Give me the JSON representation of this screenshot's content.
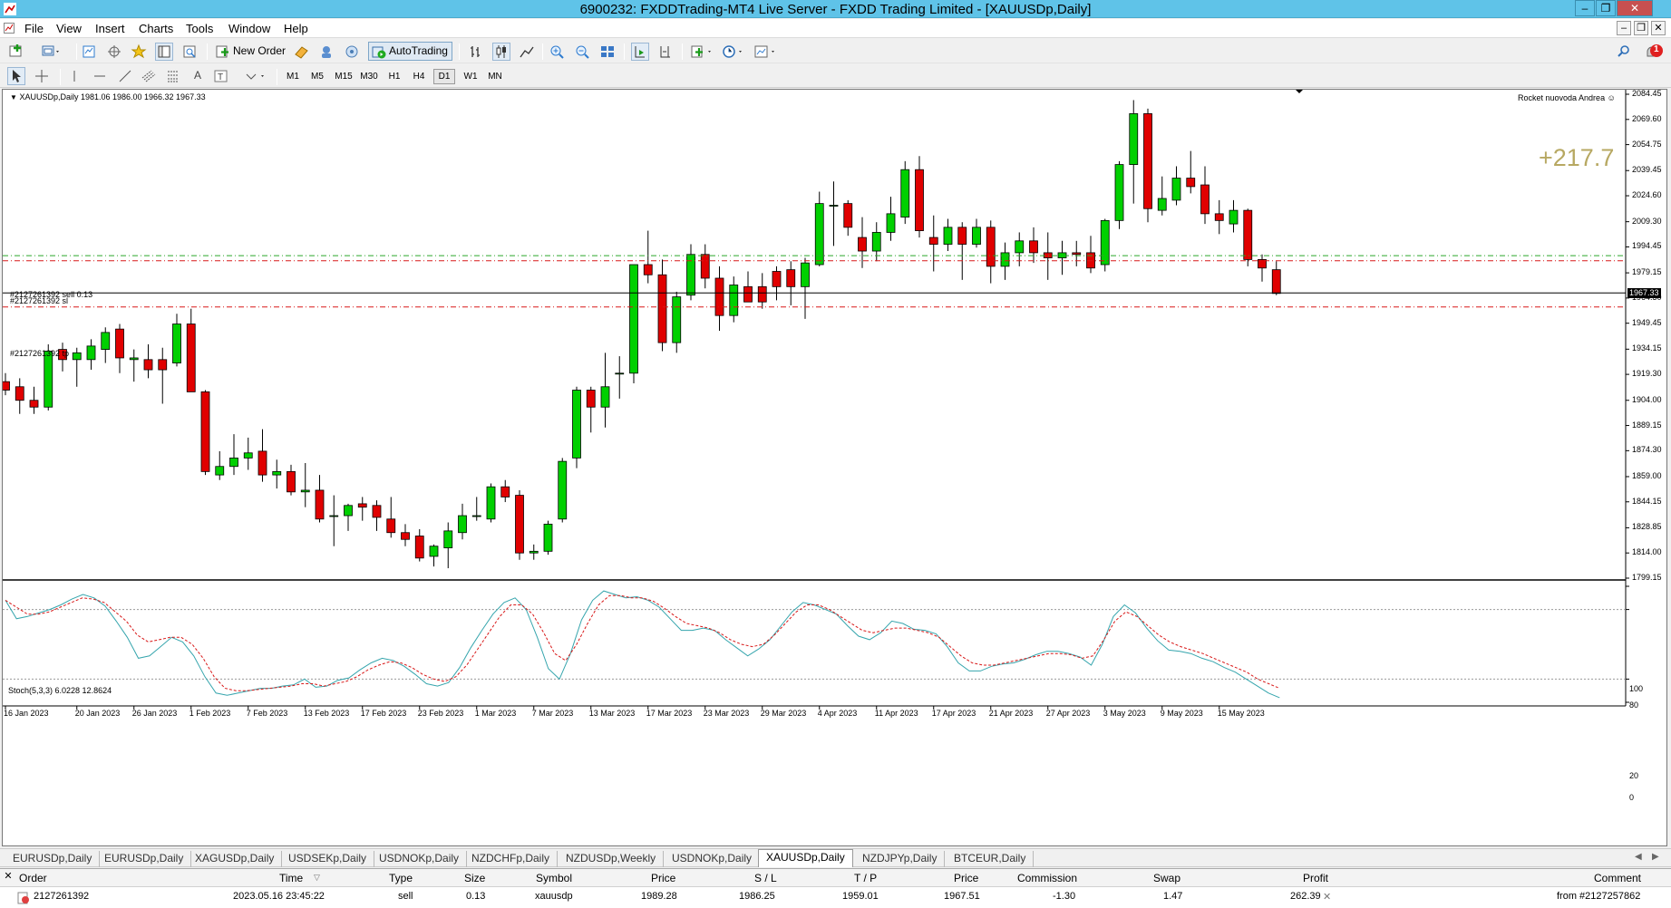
{
  "window": {
    "title": "6900232: FXDDTrading-MT4 Live Server - FXDD Trading Limited - [XAUUSDp,Daily]"
  },
  "menu": [
    "File",
    "View",
    "Insert",
    "Charts",
    "Tools",
    "Window",
    "Help"
  ],
  "toolbar": {
    "new_order": "New Order",
    "autotrading": "AutoTrading",
    "notification_count": "1",
    "timeframes": [
      "M1",
      "M5",
      "M15",
      "M30",
      "H1",
      "H4",
      "D1",
      "W1",
      "MN"
    ],
    "active_timeframe": "D1"
  },
  "chart": {
    "header": "XAUUSDp,Daily  1981.06 1986.00 1966.32 1967.33",
    "expert": "Rocket nuovoda Andrea",
    "profit_overlay": "+217.7",
    "order_line_label": "#2127261392 sell 0.13",
    "sl_label": "#2127261392 sl",
    "tp_label": "#2127261392 tp",
    "current_price": "1967.33",
    "price_axis": [
      "2084.45",
      "2069.60",
      "2054.75",
      "2039.45",
      "2024.60",
      "2009.30",
      "1994.45",
      "1979.15",
      "1964.30",
      "1949.45",
      "1934.15",
      "1919.30",
      "1904.00",
      "1889.15",
      "1874.30",
      "1859.00",
      "1844.15",
      "1828.85",
      "1814.00",
      "1799.15"
    ],
    "indicator_header": "Stoch(5,3,3) 6.0228 12.8624",
    "indicator_axis": [
      "100",
      "80",
      "20",
      "0"
    ],
    "date_axis": [
      "16 Jan 2023",
      "20 Jan 2023",
      "26 Jan 2023",
      "1 Feb 2023",
      "7 Feb 2023",
      "13 Feb 2023",
      "17 Feb 2023",
      "23 Feb 2023",
      "1 Mar 2023",
      "7 Mar 2023",
      "13 Mar 2023",
      "17 Mar 2023",
      "23 Mar 2023",
      "29 Mar 2023",
      "4 Apr 2023",
      "11 Apr 2023",
      "17 Apr 2023",
      "21 Apr 2023",
      "27 Apr 2023",
      "3 May 2023",
      "9 May 2023",
      "15 May 2023"
    ],
    "colors": {
      "bull": "#00d000",
      "bear": "#e00000",
      "order_line": "#2aa82a",
      "sl_tp_line": "#d81818",
      "stoch_main": "#35a5ad",
      "stoch_signal": "#d81818",
      "profit": "#b7a862"
    }
  },
  "chart_data": {
    "type": "candlestick",
    "title": "XAUUSDp,Daily",
    "ylim": [
      1799.15,
      2084.45
    ],
    "candles": [
      {
        "o": 1915,
        "h": 1920,
        "l": 1907,
        "c": 1910
      },
      {
        "o": 1912,
        "h": 1917,
        "l": 1896,
        "c": 1904
      },
      {
        "o": 1904,
        "h": 1912,
        "l": 1896,
        "c": 1900
      },
      {
        "o": 1900,
        "h": 1937,
        "l": 1898,
        "c": 1933
      },
      {
        "o": 1934,
        "h": 1938,
        "l": 1921,
        "c": 1928
      },
      {
        "o": 1928,
        "h": 1935,
        "l": 1912,
        "c": 1932
      },
      {
        "o": 1928,
        "h": 1940,
        "l": 1922,
        "c": 1936
      },
      {
        "o": 1934,
        "h": 1947,
        "l": 1926,
        "c": 1944
      },
      {
        "o": 1946,
        "h": 1949,
        "l": 1920,
        "c": 1929
      },
      {
        "o": 1928,
        "h": 1934,
        "l": 1915,
        "c": 1929
      },
      {
        "o": 1928,
        "h": 1937,
        "l": 1917,
        "c": 1922
      },
      {
        "o": 1928,
        "h": 1935,
        "l": 1902,
        "c": 1922
      },
      {
        "o": 1926,
        "h": 1955,
        "l": 1924,
        "c": 1949
      },
      {
        "o": 1949,
        "h": 1958,
        "l": 1910,
        "c": 1909
      },
      {
        "o": 1909,
        "h": 1910,
        "l": 1860,
        "c": 1862
      },
      {
        "o": 1860,
        "h": 1874,
        "l": 1857,
        "c": 1865
      },
      {
        "o": 1865,
        "h": 1884,
        "l": 1860,
        "c": 1870
      },
      {
        "o": 1870,
        "h": 1882,
        "l": 1863,
        "c": 1873
      },
      {
        "o": 1874,
        "h": 1887,
        "l": 1856,
        "c": 1860
      },
      {
        "o": 1860,
        "h": 1869,
        "l": 1852,
        "c": 1862
      },
      {
        "o": 1862,
        "h": 1866,
        "l": 1848,
        "c": 1850
      },
      {
        "o": 1850,
        "h": 1867,
        "l": 1841,
        "c": 1851
      },
      {
        "o": 1851,
        "h": 1860,
        "l": 1832,
        "c": 1834
      },
      {
        "o": 1836,
        "h": 1848,
        "l": 1818,
        "c": 1836
      },
      {
        "o": 1836,
        "h": 1843,
        "l": 1827,
        "c": 1842
      },
      {
        "o": 1843,
        "h": 1847,
        "l": 1833,
        "c": 1841
      },
      {
        "o": 1842,
        "h": 1845,
        "l": 1827,
        "c": 1835
      },
      {
        "o": 1834,
        "h": 1847,
        "l": 1823,
        "c": 1826
      },
      {
        "o": 1826,
        "h": 1831,
        "l": 1818,
        "c": 1822
      },
      {
        "o": 1824,
        "h": 1828,
        "l": 1809,
        "c": 1811
      },
      {
        "o": 1812,
        "h": 1819,
        "l": 1806,
        "c": 1818
      },
      {
        "o": 1817,
        "h": 1832,
        "l": 1805,
        "c": 1827
      },
      {
        "o": 1826,
        "h": 1843,
        "l": 1822,
        "c": 1836
      },
      {
        "o": 1836,
        "h": 1847,
        "l": 1833,
        "c": 1836
      },
      {
        "o": 1834,
        "h": 1855,
        "l": 1832,
        "c": 1853
      },
      {
        "o": 1853,
        "h": 1857,
        "l": 1844,
        "c": 1847
      },
      {
        "o": 1848,
        "h": 1851,
        "l": 1810,
        "c": 1814
      },
      {
        "o": 1814,
        "h": 1819,
        "l": 1810,
        "c": 1815
      },
      {
        "o": 1815,
        "h": 1833,
        "l": 1813,
        "c": 1831
      },
      {
        "o": 1834,
        "h": 1870,
        "l": 1832,
        "c": 1868
      },
      {
        "o": 1870,
        "h": 1912,
        "l": 1864,
        "c": 1910
      },
      {
        "o": 1910,
        "h": 1912,
        "l": 1885,
        "c": 1900
      },
      {
        "o": 1900,
        "h": 1932,
        "l": 1888,
        "c": 1912
      },
      {
        "o": 1920,
        "h": 1930,
        "l": 1905,
        "c": 1920
      },
      {
        "o": 1920,
        "h": 1984,
        "l": 1914,
        "c": 1984
      },
      {
        "o": 1984,
        "h": 2004,
        "l": 1973,
        "c": 1978
      },
      {
        "o": 1978,
        "h": 1987,
        "l": 1933,
        "c": 1938
      },
      {
        "o": 1938,
        "h": 1968,
        "l": 1932,
        "c": 1965
      },
      {
        "o": 1966,
        "h": 1996,
        "l": 1963,
        "c": 1990
      },
      {
        "o": 1990,
        "h": 1996,
        "l": 1970,
        "c": 1976
      },
      {
        "o": 1976,
        "h": 1983,
        "l": 1945,
        "c": 1954
      },
      {
        "o": 1954,
        "h": 1977,
        "l": 1950,
        "c": 1972
      },
      {
        "o": 1971,
        "h": 1980,
        "l": 1962,
        "c": 1962
      },
      {
        "o": 1971,
        "h": 1979,
        "l": 1958,
        "c": 1962
      },
      {
        "o": 1980,
        "h": 1983,
        "l": 1963,
        "c": 1971
      },
      {
        "o": 1981,
        "h": 1986,
        "l": 1960,
        "c": 1971
      },
      {
        "o": 1971,
        "h": 1988,
        "l": 1952,
        "c": 1985
      },
      {
        "o": 1984,
        "h": 2027,
        "l": 1983,
        "c": 2020
      },
      {
        "o": 2019,
        "h": 2033,
        "l": 1995,
        "c": 2019
      },
      {
        "o": 2020,
        "h": 2022,
        "l": 2001,
        "c": 2006
      },
      {
        "o": 2000,
        "h": 2012,
        "l": 1982,
        "c": 1992
      },
      {
        "o": 1992,
        "h": 2009,
        "l": 1986,
        "c": 2003
      },
      {
        "o": 2003,
        "h": 2024,
        "l": 1998,
        "c": 2014
      },
      {
        "o": 2012,
        "h": 2045,
        "l": 2008,
        "c": 2040
      },
      {
        "o": 2040,
        "h": 2048,
        "l": 2000,
        "c": 2004
      },
      {
        "o": 2000,
        "h": 2013,
        "l": 1980,
        "c": 1996
      },
      {
        "o": 1996,
        "h": 2011,
        "l": 1992,
        "c": 2006
      },
      {
        "o": 2006,
        "h": 2009,
        "l": 1975,
        "c": 1996
      },
      {
        "o": 1996,
        "h": 2011,
        "l": 1994,
        "c": 2006
      },
      {
        "o": 2006,
        "h": 2010,
        "l": 1973,
        "c": 1983
      },
      {
        "o": 1983,
        "h": 1997,
        "l": 1975,
        "c": 1991
      },
      {
        "o": 1991,
        "h": 2003,
        "l": 1983,
        "c": 1998
      },
      {
        "o": 1998,
        "h": 2006,
        "l": 1985,
        "c": 1991
      },
      {
        "o": 1991,
        "h": 2003,
        "l": 1975,
        "c": 1988
      },
      {
        "o": 1988,
        "h": 1998,
        "l": 1978,
        "c": 1991
      },
      {
        "o": 1991,
        "h": 1998,
        "l": 1983,
        "c": 1990
      },
      {
        "o": 1991,
        "h": 2001,
        "l": 1979,
        "c": 1982
      },
      {
        "o": 1984,
        "h": 2011,
        "l": 1980,
        "c": 2010
      },
      {
        "o": 2010,
        "h": 2045,
        "l": 2005,
        "c": 2043
      },
      {
        "o": 2043,
        "h": 2081,
        "l": 2020,
        "c": 2073
      },
      {
        "o": 2073,
        "h": 2076,
        "l": 2009,
        "c": 2017
      },
      {
        "o": 2016,
        "h": 2036,
        "l": 2013,
        "c": 2023
      },
      {
        "o": 2022,
        "h": 2042,
        "l": 2019,
        "c": 2035
      },
      {
        "o": 2035,
        "h": 2051,
        "l": 2026,
        "c": 2030
      },
      {
        "o": 2031,
        "h": 2042,
        "l": 2008,
        "c": 2014
      },
      {
        "o": 2014,
        "h": 2022,
        "l": 2002,
        "c": 2010
      },
      {
        "o": 2008,
        "h": 2022,
        "l": 2003,
        "c": 2016
      },
      {
        "o": 2016,
        "h": 2017,
        "l": 1983,
        "c": 1987
      },
      {
        "o": 1987,
        "h": 1990,
        "l": 1974,
        "c": 1982
      },
      {
        "o": 1981,
        "h": 1986,
        "l": 1966,
        "c": 1967
      }
    ],
    "lines": [
      {
        "name": "#2127261392 sell 0.13",
        "value": 1989.28,
        "style": "dash-dot",
        "color": "#2aa82a"
      },
      {
        "name": "#2127261392 sl",
        "value": 1986.25,
        "style": "dash-dot",
        "color": "#d81818"
      },
      {
        "name": "#2127261392 tp",
        "value": 1959.01,
        "style": "dash-dot",
        "color": "#d81818"
      },
      {
        "name": "bid",
        "value": 1967.33,
        "style": "solid",
        "color": "#000000"
      }
    ],
    "indicator": {
      "name": "Stoch(5,3,3)",
      "ylim": [
        0,
        100
      ],
      "levels": [
        80,
        20
      ],
      "main": [
        88,
        72,
        74,
        77,
        80,
        84,
        89,
        93,
        90,
        83,
        70,
        56,
        38,
        40,
        48,
        56,
        52,
        40,
        22,
        8,
        6,
        8,
        10,
        12,
        12,
        14,
        15,
        20,
        13,
        14,
        19,
        21,
        28,
        34,
        38,
        36,
        31,
        24,
        16,
        14,
        17,
        30,
        47,
        62,
        76,
        86,
        90,
        80,
        56,
        29,
        20,
        42,
        71,
        88,
        96,
        93,
        90,
        91,
        88,
        82,
        72,
        62,
        62,
        64,
        62,
        54,
        47,
        40,
        46,
        54,
        66,
        78,
        86,
        84,
        80,
        76,
        66,
        57,
        54,
        60,
        70,
        68,
        63,
        62,
        59,
        48,
        34,
        27,
        27,
        31,
        33,
        34,
        37,
        41,
        44,
        44,
        42,
        39,
        32,
        50,
        74,
        84,
        77,
        64,
        53,
        45,
        44,
        42,
        38,
        35,
        30,
        26,
        20,
        14,
        8,
        4
      ],
      "signal": [
        88,
        82,
        76,
        76,
        78,
        82,
        86,
        90,
        89,
        86,
        78,
        70,
        58,
        52,
        54,
        56,
        56,
        50,
        38,
        22,
        12,
        10,
        10,
        11,
        12,
        13,
        14,
        16,
        16,
        14,
        16,
        18,
        22,
        28,
        32,
        35,
        34,
        30,
        24,
        20,
        18,
        22,
        32,
        46,
        60,
        74,
        84,
        84,
        76,
        60,
        42,
        36,
        50,
        68,
        84,
        92,
        92,
        90,
        90,
        87,
        81,
        74,
        68,
        66,
        64,
        60,
        54,
        50,
        48,
        50,
        58,
        68,
        78,
        84,
        84,
        80,
        74,
        68,
        62,
        60,
        62,
        64,
        64,
        62,
        60,
        56,
        48,
        40,
        34,
        32,
        32,
        34,
        36,
        38,
        40,
        42,
        42,
        41,
        38,
        40,
        54,
        70,
        78,
        74,
        66,
        58,
        52,
        48,
        45,
        42,
        38,
        34,
        30,
        26,
        20,
        16,
        12
      ]
    }
  },
  "tabs": [
    "EURUSDp,Daily",
    "EURUSDp,Daily",
    "XAGUSDp,Daily",
    "USDSEKp,Daily",
    "USDNOKp,Daily",
    "NZDCHFp,Daily",
    "NZDUSDp,Weekly",
    "USDNOKp,Daily",
    "XAUUSDp,Daily",
    "NZDJPYp,Daily",
    "BTCEUR,Daily"
  ],
  "active_tab": "XAUUSDp,Daily",
  "terminal": {
    "headers": [
      "Order",
      "Time",
      "Type",
      "Size",
      "Symbol",
      "Price",
      "S / L",
      "T / P",
      "Price",
      "Commission",
      "Swap",
      "Profit",
      "Comment"
    ],
    "row": {
      "order": "2127261392",
      "time": "2023.05.16 23:45:22",
      "type": "sell",
      "size": "0.13",
      "symbol": "xauusdp",
      "price": "1989.28",
      "sl": "1986.25",
      "tp": "1959.01",
      "cur_price": "1967.51",
      "commission": "-1.30",
      "swap": "1.47",
      "profit": "262.39",
      "comment": "from #2127257862"
    }
  }
}
